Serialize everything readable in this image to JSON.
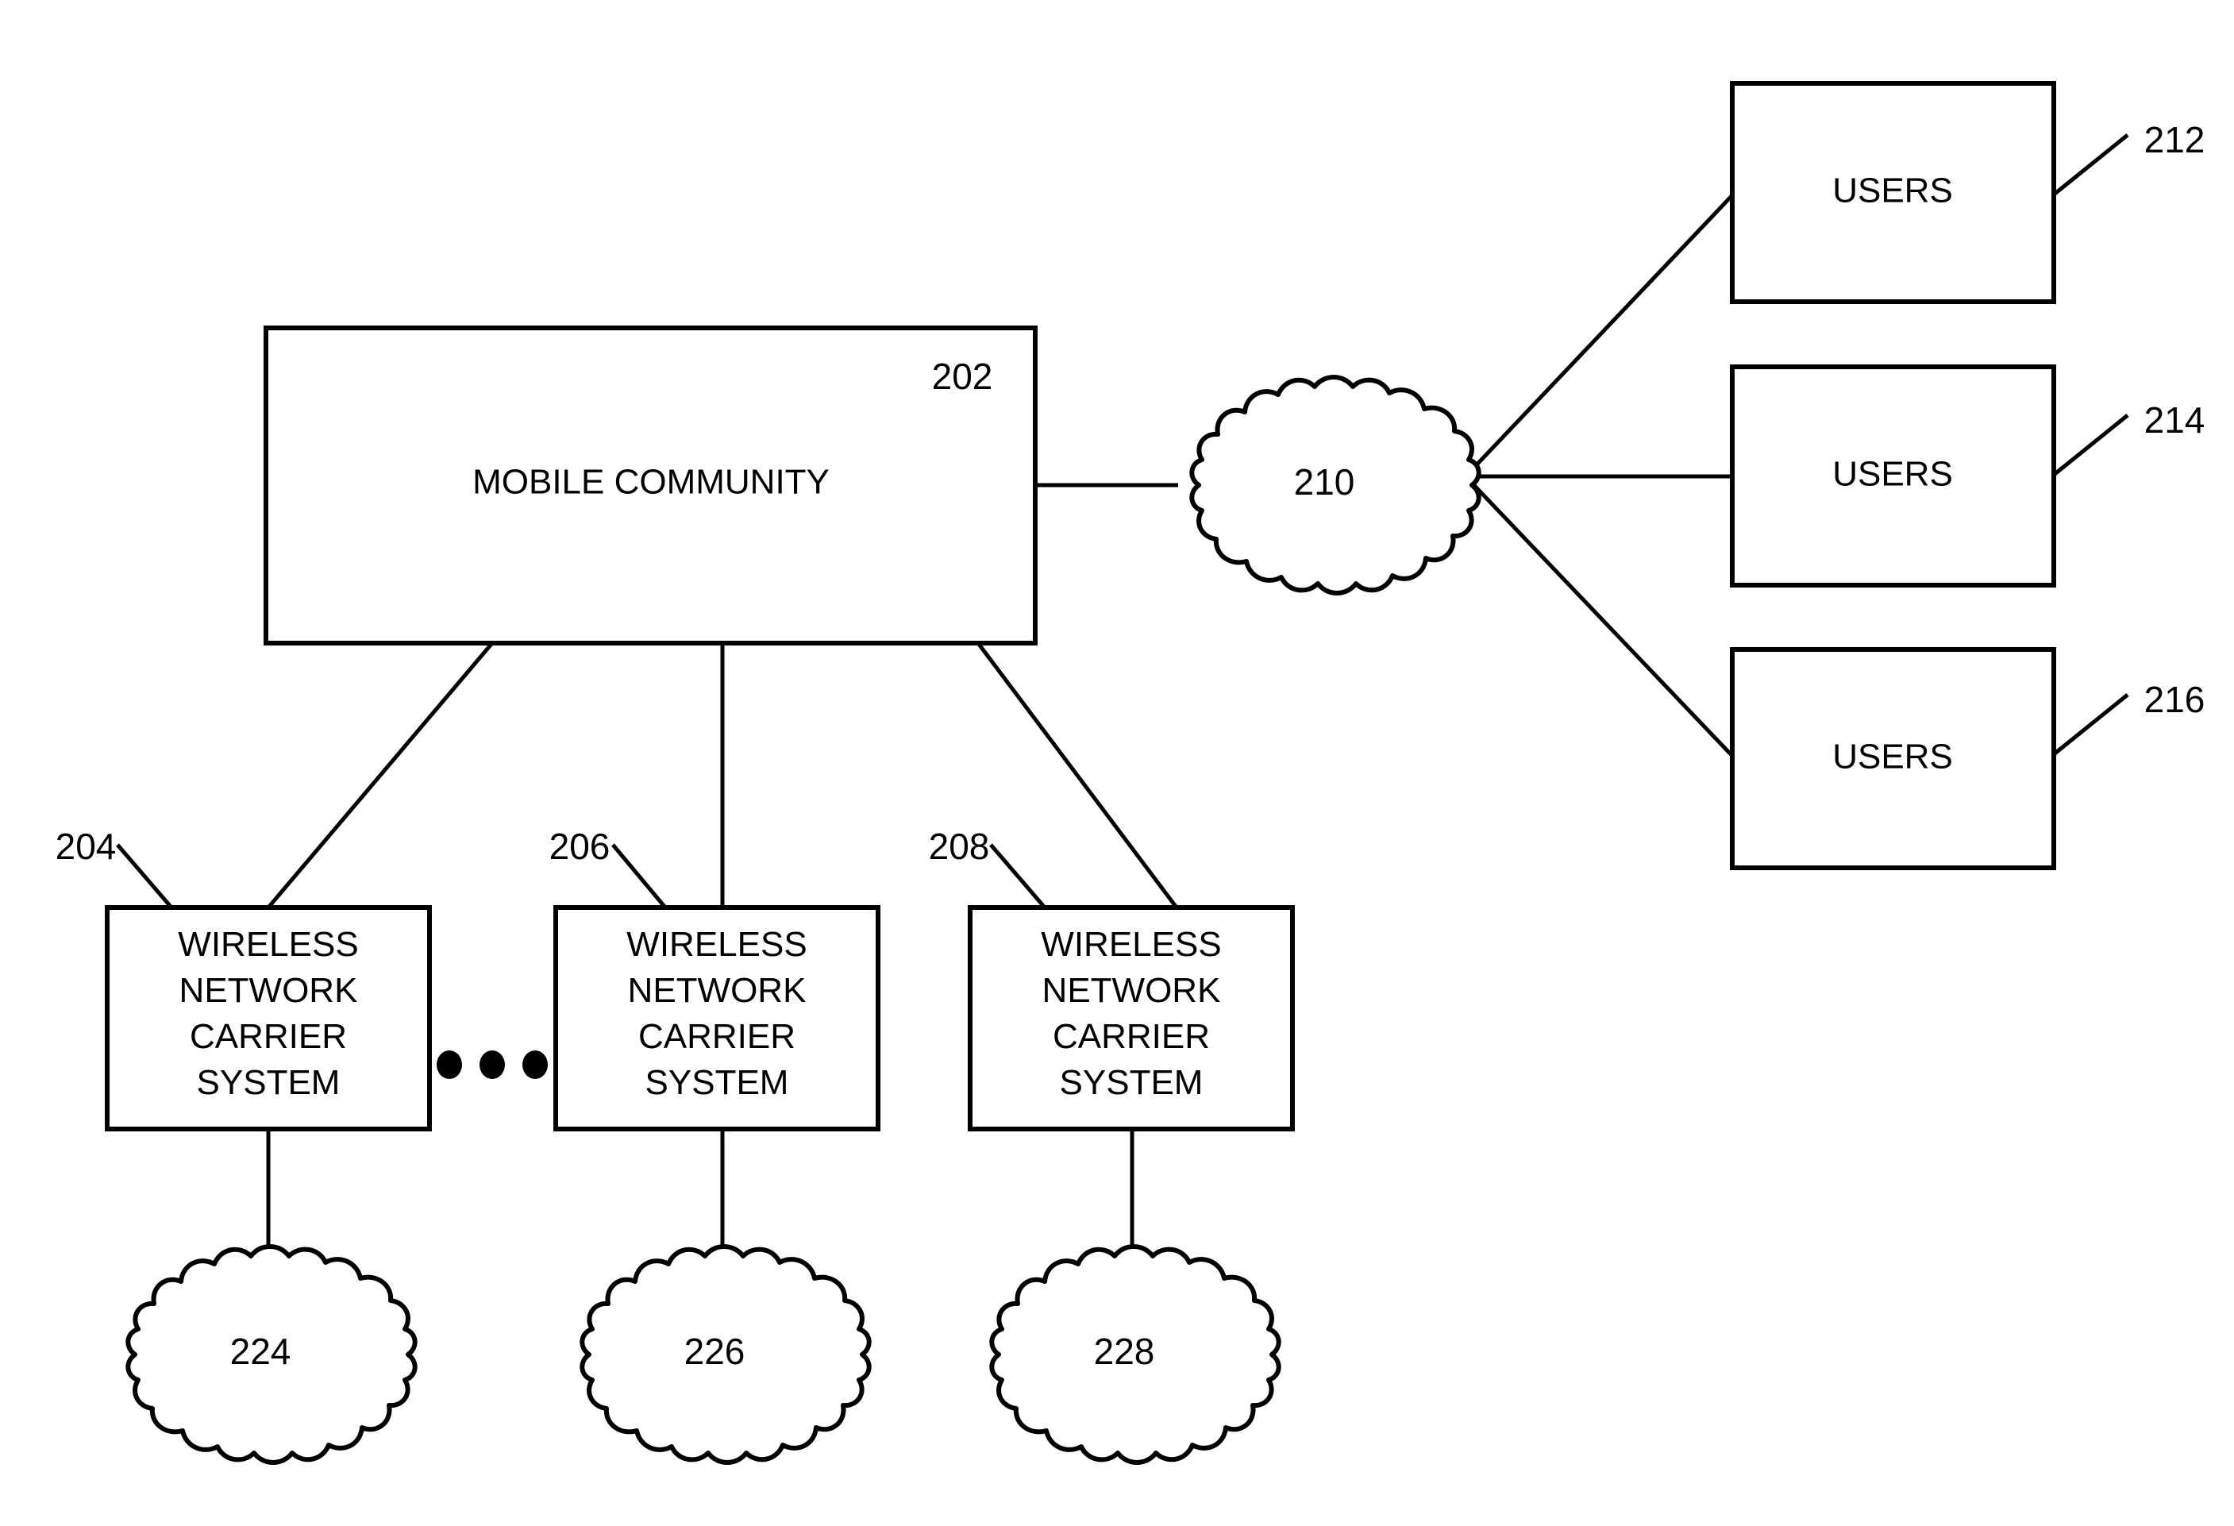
{
  "diagram": {
    "type": "patent-network-diagram",
    "background_color": "#ffffff",
    "line_color": "#000000",
    "nodes": {
      "mobile_community": {
        "label": "MOBILE COMMUNITY",
        "ref": "202"
      },
      "carriers": [
        {
          "line1": "WIRELESS",
          "line2": "NETWORK",
          "line3": "CARRIER",
          "line4": "SYSTEM",
          "ref": "204"
        },
        {
          "line1": "WIRELESS",
          "line2": "NETWORK",
          "line3": "CARRIER",
          "line4": "SYSTEM",
          "ref": "206"
        },
        {
          "line1": "WIRELESS",
          "line2": "NETWORK",
          "line3": "CARRIER",
          "line4": "SYSTEM",
          "ref": "208"
        }
      ],
      "users": [
        {
          "label": "USERS",
          "ref": "212"
        },
        {
          "label": "USERS",
          "ref": "214"
        },
        {
          "label": "USERS",
          "ref": "216"
        }
      ],
      "network_cloud": {
        "ref": "210"
      },
      "carrier_clouds": [
        {
          "ref": "224"
        },
        {
          "ref": "226"
        },
        {
          "ref": "228"
        }
      ]
    },
    "ellipsis": {
      "dot_count": 3,
      "meaning": "continuation-between-carrier-systems"
    }
  }
}
